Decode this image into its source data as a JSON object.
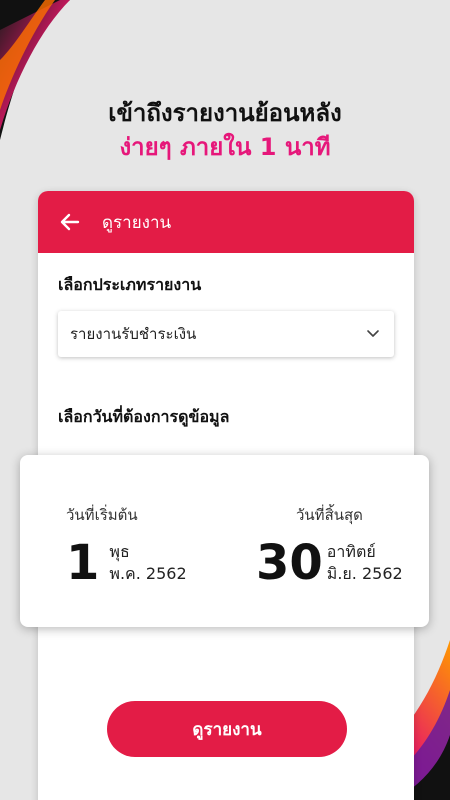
{
  "headline": {
    "line1": "เข้าถึงรายงานย้อนหลัง",
    "line2": "ง่ายๆ ภายใน 1 นาที"
  },
  "appbar": {
    "back_icon": "arrow-left-icon",
    "title": "ดูรายงาน"
  },
  "report_type": {
    "label": "เลือกประเภทรายงาน",
    "selected": "รายงานรับชำระเงิน",
    "dropdown_icon": "chevron-down-icon"
  },
  "date_range": {
    "label": "เลือกวันที่ต้องการดูข้อมูล",
    "start": {
      "caption": "วันที่เริ่มต้น",
      "day": "1",
      "weekday": "พุธ",
      "month_year": "พ.ค. 2562"
    },
    "end": {
      "caption": "วันที่สิ้นสุด",
      "day": "30",
      "weekday": "อาทิตย์",
      "month_year": "มิ.ย. 2562"
    }
  },
  "action_button": "ดูรายงาน",
  "colors": {
    "accent": "#e31c46",
    "headline_pink": "#e6177a",
    "background": "#e6e6e6"
  }
}
